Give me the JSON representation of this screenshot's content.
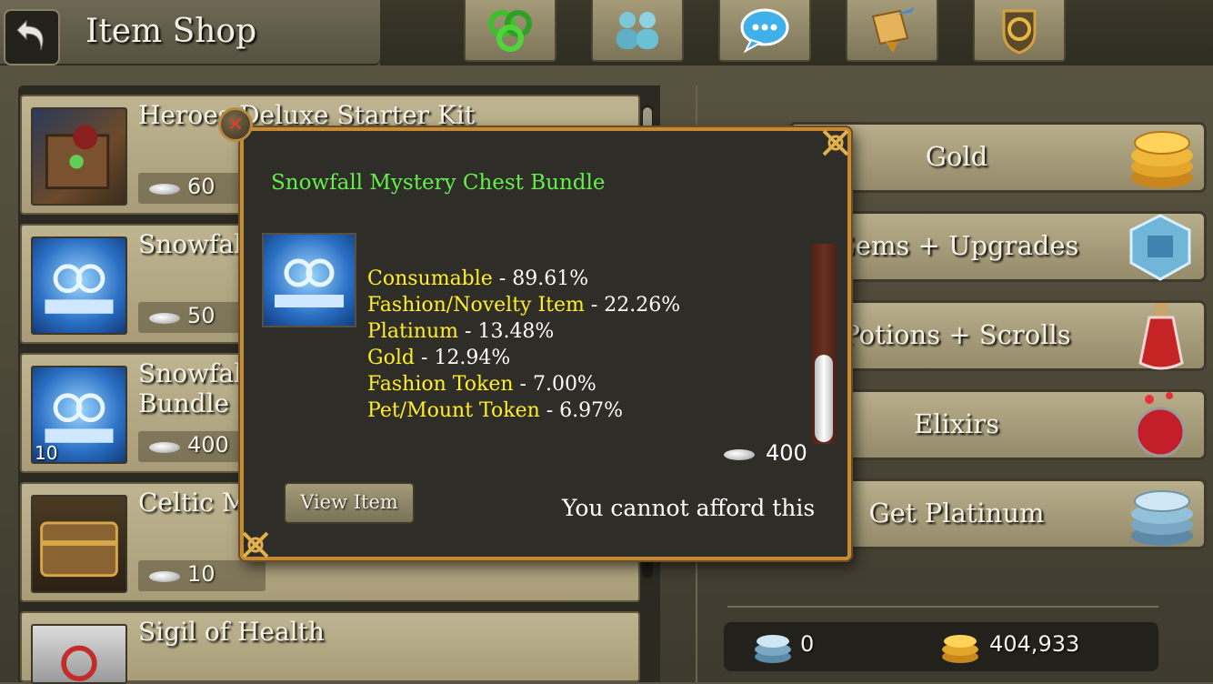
{
  "header": {
    "title": "Item Shop",
    "tabs": [
      {
        "icon": "triskelion-icon"
      },
      {
        "icon": "friends-icon"
      },
      {
        "icon": "chat-icon"
      },
      {
        "icon": "quest-scroll-icon"
      },
      {
        "icon": "guild-crest-icon"
      }
    ]
  },
  "items": [
    {
      "name": "Heroes Deluxe Starter Kit",
      "price": "60",
      "qty": ""
    },
    {
      "name": "Snowfall Mystery Chest",
      "price": "50",
      "qty": ""
    },
    {
      "name": "Snowfall Mystery Chest\nBundle",
      "price": "400",
      "qty": "10"
    },
    {
      "name": "Celtic Mystery Chest",
      "price": "10",
      "qty": ""
    },
    {
      "name": "Sigil of Health",
      "price": "",
      "qty": ""
    }
  ],
  "categories": [
    {
      "label": "Gold",
      "icon": "gold-stack-icon"
    },
    {
      "label": "Gems + Upgrades",
      "icon": "gem-icon"
    },
    {
      "label": "Potions + Scrolls",
      "icon": "potion-icon"
    },
    {
      "label": "Elixirs",
      "icon": "elixir-icon"
    },
    {
      "label": "Get Platinum",
      "icon": "platinum-stack-icon"
    }
  ],
  "currency": {
    "platinum": "0",
    "gold": "404,933"
  },
  "popup": {
    "title": "Snowfall Mystery Chest Bundle",
    "drops": [
      {
        "name": "Consumable",
        "pct": " - 89.61%"
      },
      {
        "name": "Fashion/Novelty Item",
        "pct": " - 22.26%"
      },
      {
        "name": "Platinum",
        "pct": " - 13.48%"
      },
      {
        "name": "Gold",
        "pct": " - 12.94%"
      },
      {
        "name": "Fashion Token",
        "pct": " - 7.00%"
      },
      {
        "name": "Pet/Mount Token",
        "pct": " - 6.97%"
      }
    ],
    "price": "400",
    "view_button": "View Item",
    "afford_message": "You cannot afford this",
    "close_symbol": "✕"
  },
  "colors": {
    "popup_border": "#c48a36",
    "title_green": "#63f04a",
    "drop_yellow": "#ffee2a"
  }
}
